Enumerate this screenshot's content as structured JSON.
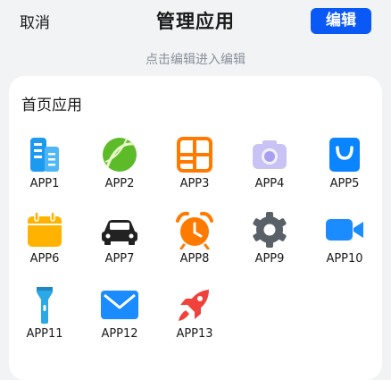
{
  "header": {
    "cancel_label": "取消",
    "title": "管理应用",
    "edit_label": "编辑"
  },
  "hint": "点击编辑进入编辑",
  "section": {
    "title": "首页应用",
    "apps": [
      {
        "label": "APP1",
        "icon": "building-icon",
        "color": "#1b9af0"
      },
      {
        "label": "APP2",
        "icon": "ball-icon",
        "color": "#5dbb2a"
      },
      {
        "label": "APP3",
        "icon": "grid-window-icon",
        "color": "#ff7a00"
      },
      {
        "label": "APP4",
        "icon": "camera-icon",
        "color": "#c9c3f5"
      },
      {
        "label": "APP5",
        "icon": "shopping-bag-icon",
        "color": "#0a84ff"
      },
      {
        "label": "APP6",
        "icon": "calendar-icon",
        "color": "#ffb300"
      },
      {
        "label": "APP7",
        "icon": "car-icon",
        "color": "#222222"
      },
      {
        "label": "APP8",
        "icon": "alarm-clock-icon",
        "color": "#ff7a00"
      },
      {
        "label": "APP9",
        "icon": "gear-icon",
        "color": "#5a6068"
      },
      {
        "label": "APP10",
        "icon": "video-camera-icon",
        "color": "#1a8cff"
      },
      {
        "label": "APP11",
        "icon": "flashlight-icon",
        "color": "#2ba8e6"
      },
      {
        "label": "APP12",
        "icon": "mail-icon",
        "color": "#1a8cff"
      },
      {
        "label": "APP13",
        "icon": "rocket-icon",
        "color": "#f0413a"
      }
    ]
  }
}
